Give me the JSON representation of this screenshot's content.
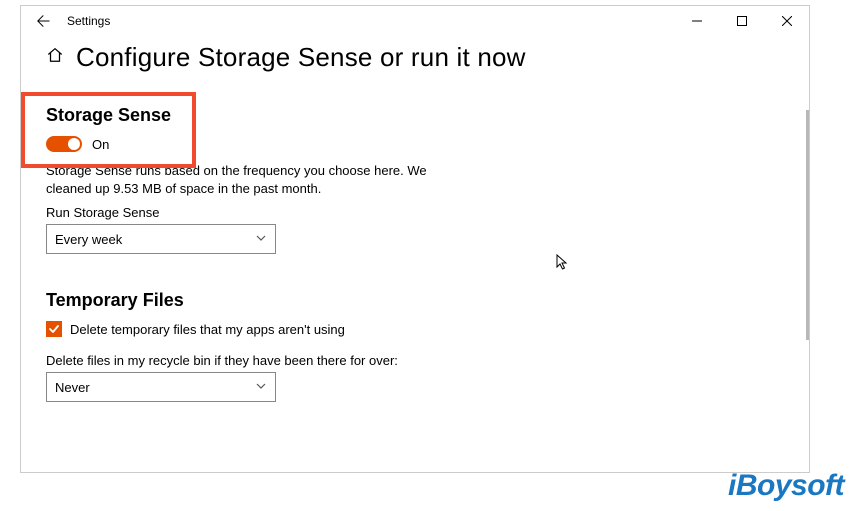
{
  "window": {
    "title": "Settings"
  },
  "header": {
    "page_title": "Configure Storage Sense or run it now"
  },
  "storage_sense": {
    "section_title": "Storage Sense",
    "toggle_state": "On",
    "description": "Storage Sense runs based on the frequency you choose here. We cleaned up 9.53 MB of space in the past month.",
    "run_label": "Run Storage Sense",
    "run_value": "Every week"
  },
  "temporary_files": {
    "section_title": "Temporary Files",
    "checkbox_label": "Delete temporary files that my apps aren't using",
    "checkbox_checked": true,
    "recycle_label": "Delete files in my recycle bin if they have been there for over:",
    "recycle_value": "Never"
  },
  "watermark": "iBoysoft"
}
